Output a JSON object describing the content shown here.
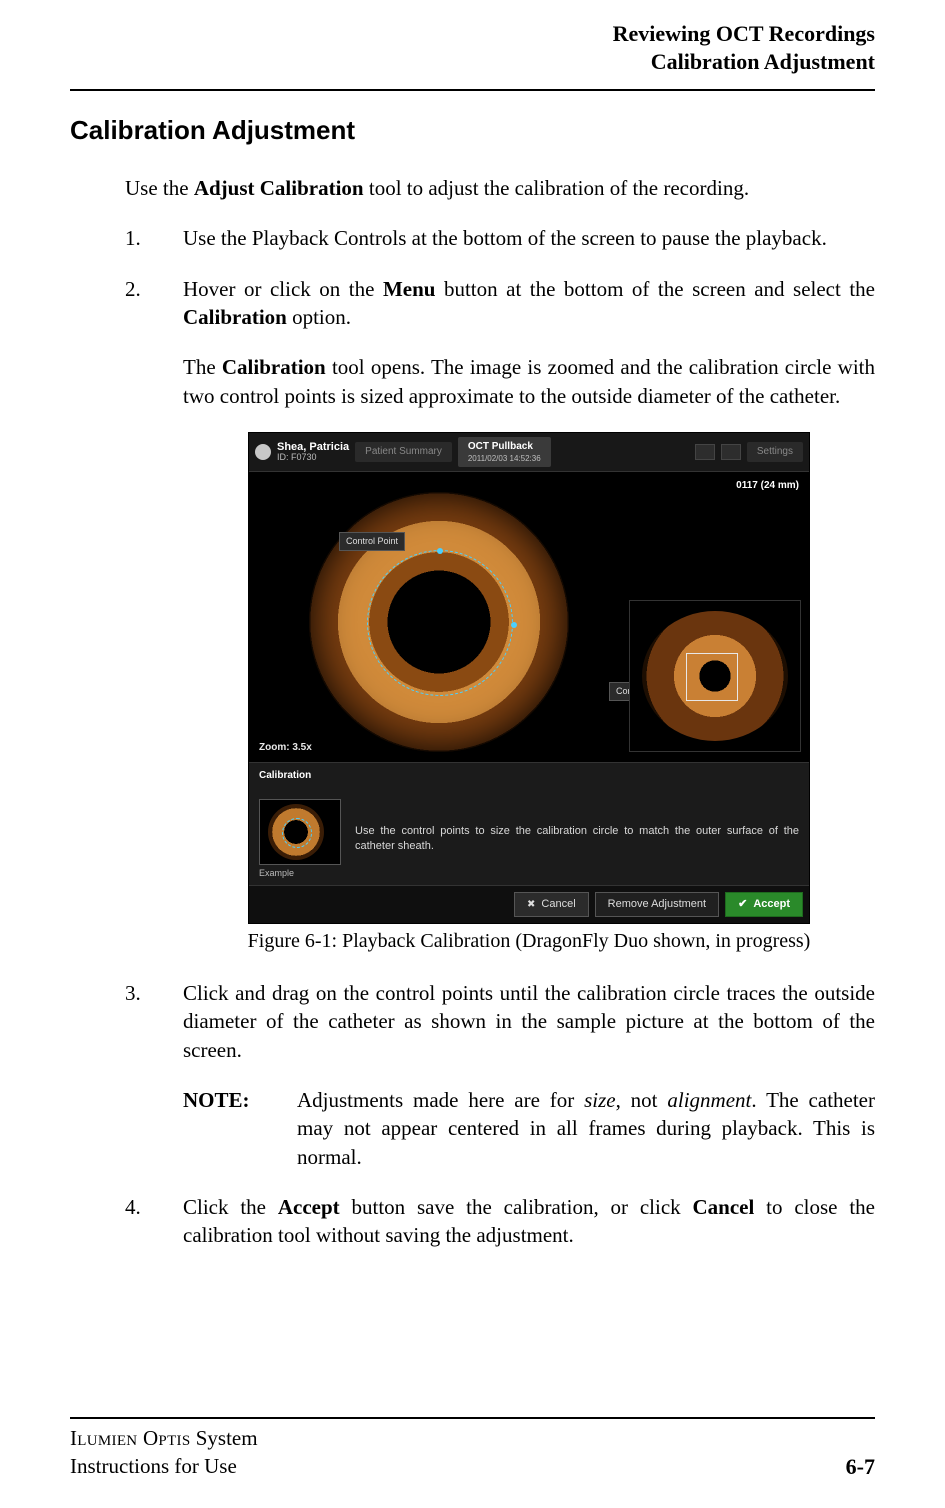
{
  "header": {
    "line1": "Reviewing OCT Recordings",
    "line2": "Calibration Adjustment"
  },
  "section_title": "Calibration Adjustment",
  "intro": {
    "pre": "Use the ",
    "bold": "Adjust Calibration",
    "post": " tool to adjust the calibration of the recording."
  },
  "steps": {
    "s1": "Use the Playback Controls at the bottom of the screen to pause the playback.",
    "s2": {
      "p1_pre": "Hover or click on the ",
      "p1_b1": "Menu",
      "p1_mid": " button at the bottom of the screen and select the ",
      "p1_b2": "Cali­bration",
      "p1_post": " option.",
      "p2_pre": "The ",
      "p2_b": "Calibration",
      "p2_post": " tool opens. The image is zoomed and the calibration circle with two control points is sized approximate to the outside diameter of the catheter."
    },
    "s3": {
      "p1": "Click and drag on the control points until the calibration circle traces the outside diameter of the catheter as shown in the sample picture at the bottom of the screen.",
      "note_label": "NOTE:",
      "note_pre": "Adjustments made here are for ",
      "note_em1": "size",
      "note_mid": ", not ",
      "note_em2": "alignment",
      "note_post": ". The catheter may not appear centered in all frames during playback. This is normal."
    },
    "s4": {
      "pre": "Click the ",
      "b1": "Accept",
      "mid": " button save the calibration, or click ",
      "b2": "Cancel",
      "post": " to close the calibration tool without saving the adjustment."
    }
  },
  "figure": {
    "caption": "Figure 6-1:  Playback Calibration (DragonFly Duo shown, in progress)",
    "patient_name": "Shea, Patricia",
    "patient_id": "ID: F0730",
    "tab_summary": "Patient Summary",
    "tab_pullback": "OCT Pullback",
    "tab_pullback_sub": "2011/02/03 14:52:36",
    "settings": "Settings",
    "frame_info": "0117 (24 mm)",
    "control_point": "Control Point",
    "zoom": "Zoom: 3.5x",
    "panel_title": "Calibration",
    "example_label": "Example",
    "hint": "Use the control points to size the calibration circle to match the outer surface of the catheter sheath.",
    "btn_cancel": "Cancel",
    "btn_remove": "Remove Adjustment",
    "btn_accept": "Accept"
  },
  "footer": {
    "product_sc": "Ilumien Optis",
    "product_rest": " System",
    "line2": "Instructions for Use",
    "page": "6-7"
  }
}
